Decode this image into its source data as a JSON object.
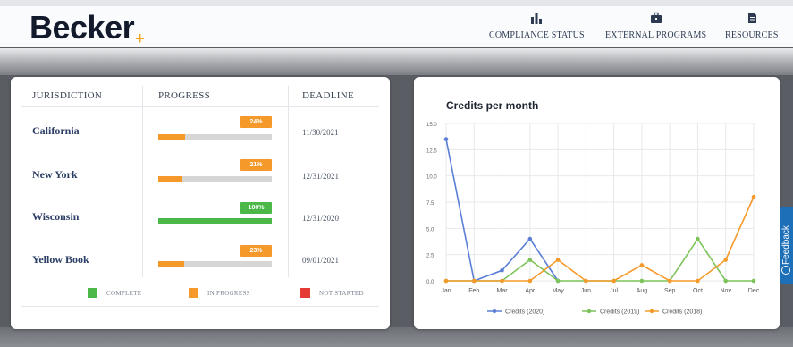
{
  "app": {
    "logo_text": "Becker",
    "logo_plus": "+"
  },
  "nav": [
    {
      "label": "COMPLIANCE STATUS",
      "icon": "bar-chart-icon"
    },
    {
      "label": "EXTERNAL PROGRAMS",
      "icon": "briefcase-icon"
    },
    {
      "label": "RESOURCES",
      "icon": "document-icon"
    }
  ],
  "progress_table": {
    "headers": {
      "jurisdiction": "JURISDICTION",
      "progress": "PROGRESS",
      "deadline": "DEADLINE"
    },
    "rows": [
      {
        "jurisdiction": "California",
        "percent_label": "24%",
        "percent": 24,
        "status": "in-progress",
        "deadline": "11/30/2021"
      },
      {
        "jurisdiction": "New York",
        "percent_label": "21%",
        "percent": 21,
        "status": "in-progress",
        "deadline": "12/31/2021"
      },
      {
        "jurisdiction": "Wisconsin",
        "percent_label": "100%",
        "percent": 100,
        "status": "complete",
        "deadline": "12/31/2020"
      },
      {
        "jurisdiction": "Yellow Book",
        "percent_label": "23%",
        "percent": 23,
        "status": "in-progress",
        "deadline": "09/01/2021"
      }
    ],
    "legend": [
      {
        "label": "COMPLETE",
        "color": "#4cb848"
      },
      {
        "label": "IN PROGRESS",
        "color": "#f59a2a"
      },
      {
        "label": "NOT STARTED",
        "color": "#e53935"
      }
    ]
  },
  "chart_data": {
    "type": "line",
    "title": "Credits per month",
    "categories": [
      "Jan",
      "Feb",
      "Mar",
      "Apr",
      "May",
      "Jun",
      "Jul",
      "Aug",
      "Sep",
      "Oct",
      "Nov",
      "Dec"
    ],
    "y_ticks": [
      "0.0",
      "2.5",
      "5.0",
      "7.5",
      "10.0",
      "12.5",
      "15.0"
    ],
    "ylim": [
      0,
      15
    ],
    "grid": true,
    "legend_position": "bottom",
    "series": [
      {
        "name": "Credits (2020)",
        "color": "#5b7fd6",
        "values": [
          13.5,
          0,
          1,
          4,
          0,
          null,
          null,
          null,
          null,
          null,
          null,
          null
        ]
      },
      {
        "name": "Credits (2019)",
        "color": "#7cc35a",
        "values": [
          0,
          0,
          0,
          2,
          0,
          0,
          0,
          0,
          0,
          4,
          0,
          0
        ]
      },
      {
        "name": "Credits (2018)",
        "color": "#f59a2a",
        "values": [
          0,
          0,
          0,
          0,
          2,
          0,
          0,
          1.5,
          0,
          0,
          2,
          8
        ]
      }
    ]
  },
  "feedback": {
    "label": "Feedback",
    "icon": "smile-icon"
  }
}
